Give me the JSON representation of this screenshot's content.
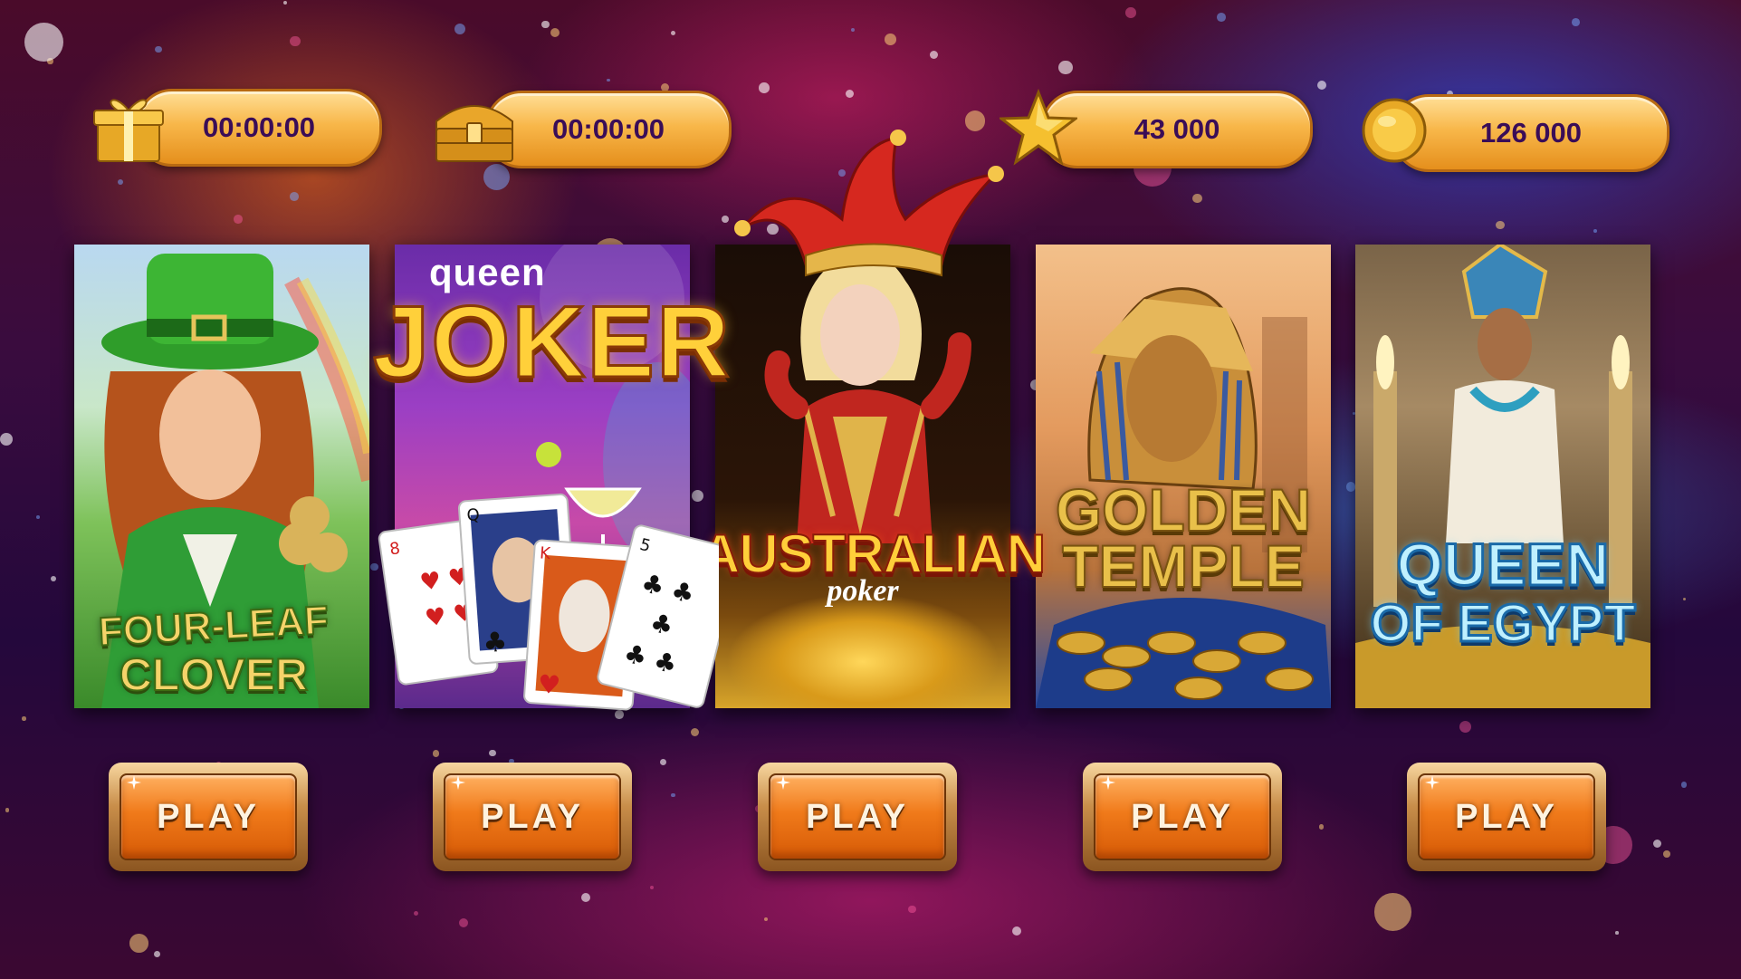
{
  "timers": {
    "gift": {
      "value": "00:00:00",
      "icon": "gift-box-icon"
    },
    "chest": {
      "value": "00:00:00",
      "icon": "treasure-chest-icon"
    }
  },
  "currencies": {
    "stars": {
      "value": "43 000",
      "icon": "star-icon"
    },
    "coins": {
      "value": "126 000",
      "icon": "coin-icon"
    }
  },
  "games": [
    {
      "id": "four-leaf-clover",
      "title_line1": "FOUR-LEAF",
      "title_line2": "CLOVER",
      "play_label": "PLAY"
    },
    {
      "id": "queen-joker",
      "title_small": "queen",
      "title_big": "JOKER",
      "play_label": "PLAY"
    },
    {
      "id": "australian-poker",
      "title_big": "AUSTRALIAN",
      "title_small": "poker",
      "play_label": "PLAY"
    },
    {
      "id": "golden-temple",
      "title_line1": "GOLDEN",
      "title_line2": "TEMPLE",
      "play_label": "PLAY"
    },
    {
      "id": "queen-of-egypt",
      "title_line1": "QUEEN",
      "title_line2": "OF EGYPT",
      "play_label": "PLAY"
    }
  ],
  "colors": {
    "pill_text": "#3a0d57",
    "pill_gold": "#f8b74a",
    "play_orange": "#f07a1a"
  }
}
